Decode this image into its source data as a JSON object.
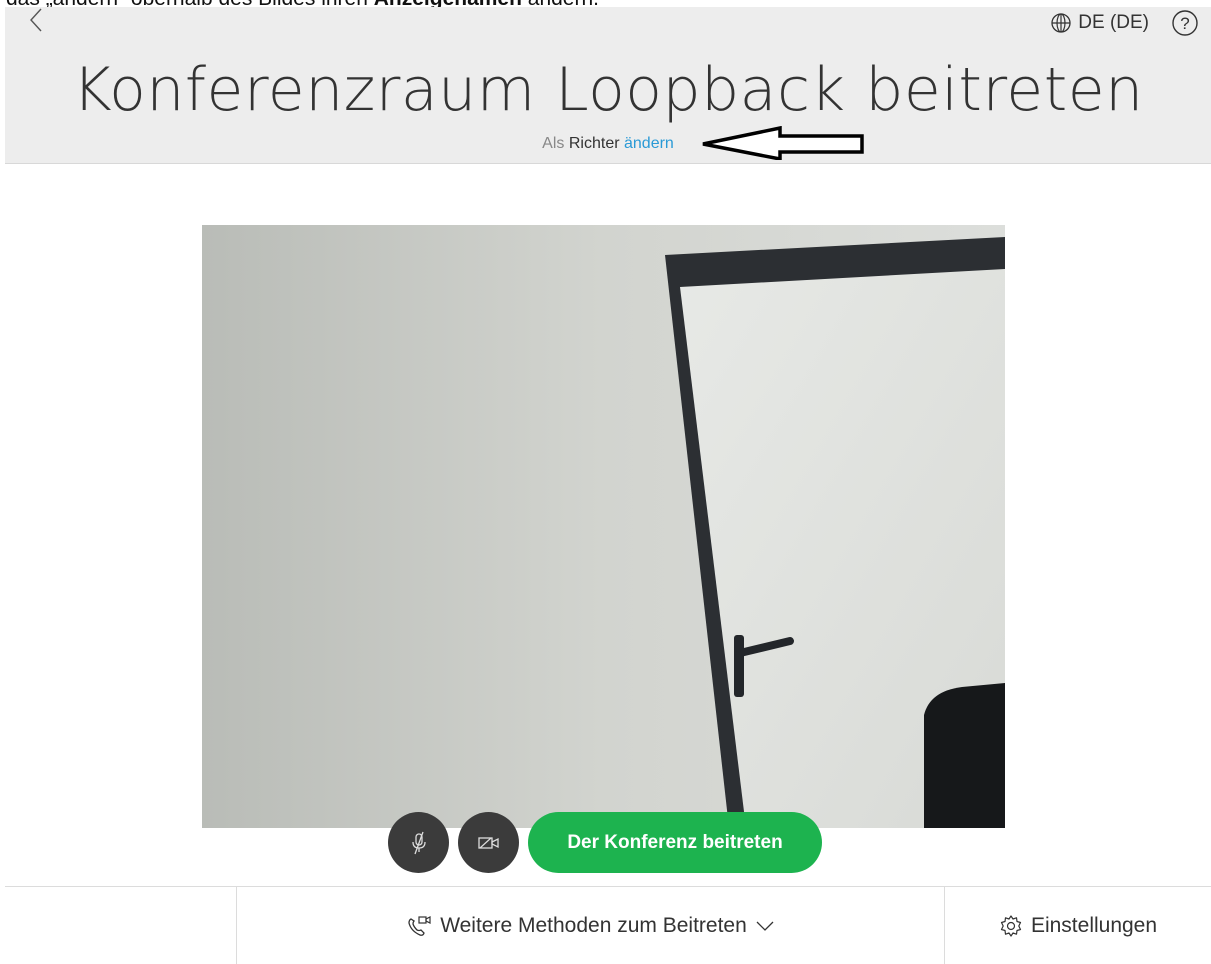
{
  "caption": {
    "text_before": "das „ändern“ oberhalb des Bildes ihren ",
    "text_bold": "Anzeigenamen",
    "text_after": " ändern."
  },
  "header": {
    "back_icon": "chevron-left-icon",
    "language": "DE (DE)",
    "language_icon": "globe-icon",
    "help_icon": "help-circle-icon",
    "title": "Konferenzraum Loopback beitreten",
    "subtitle_prefix": "Als",
    "role": "Richter",
    "change_link": "ändern"
  },
  "controls": {
    "mute_icon": "microphone-muted-icon",
    "camera_icon": "camera-icon",
    "join_label": "Der Konferenz beitreten",
    "join_color": "#1db34f"
  },
  "footer": {
    "more_methods_label": "Weitere Methoden zum Beitreten",
    "more_methods_icon": "phone-video-icon",
    "more_methods_chevron": "chevron-down-icon",
    "settings_label": "Einstellungen",
    "settings_icon": "gear-icon"
  },
  "colors": {
    "accent_link": "#2a9ad6",
    "header_bg": "#ededed"
  }
}
